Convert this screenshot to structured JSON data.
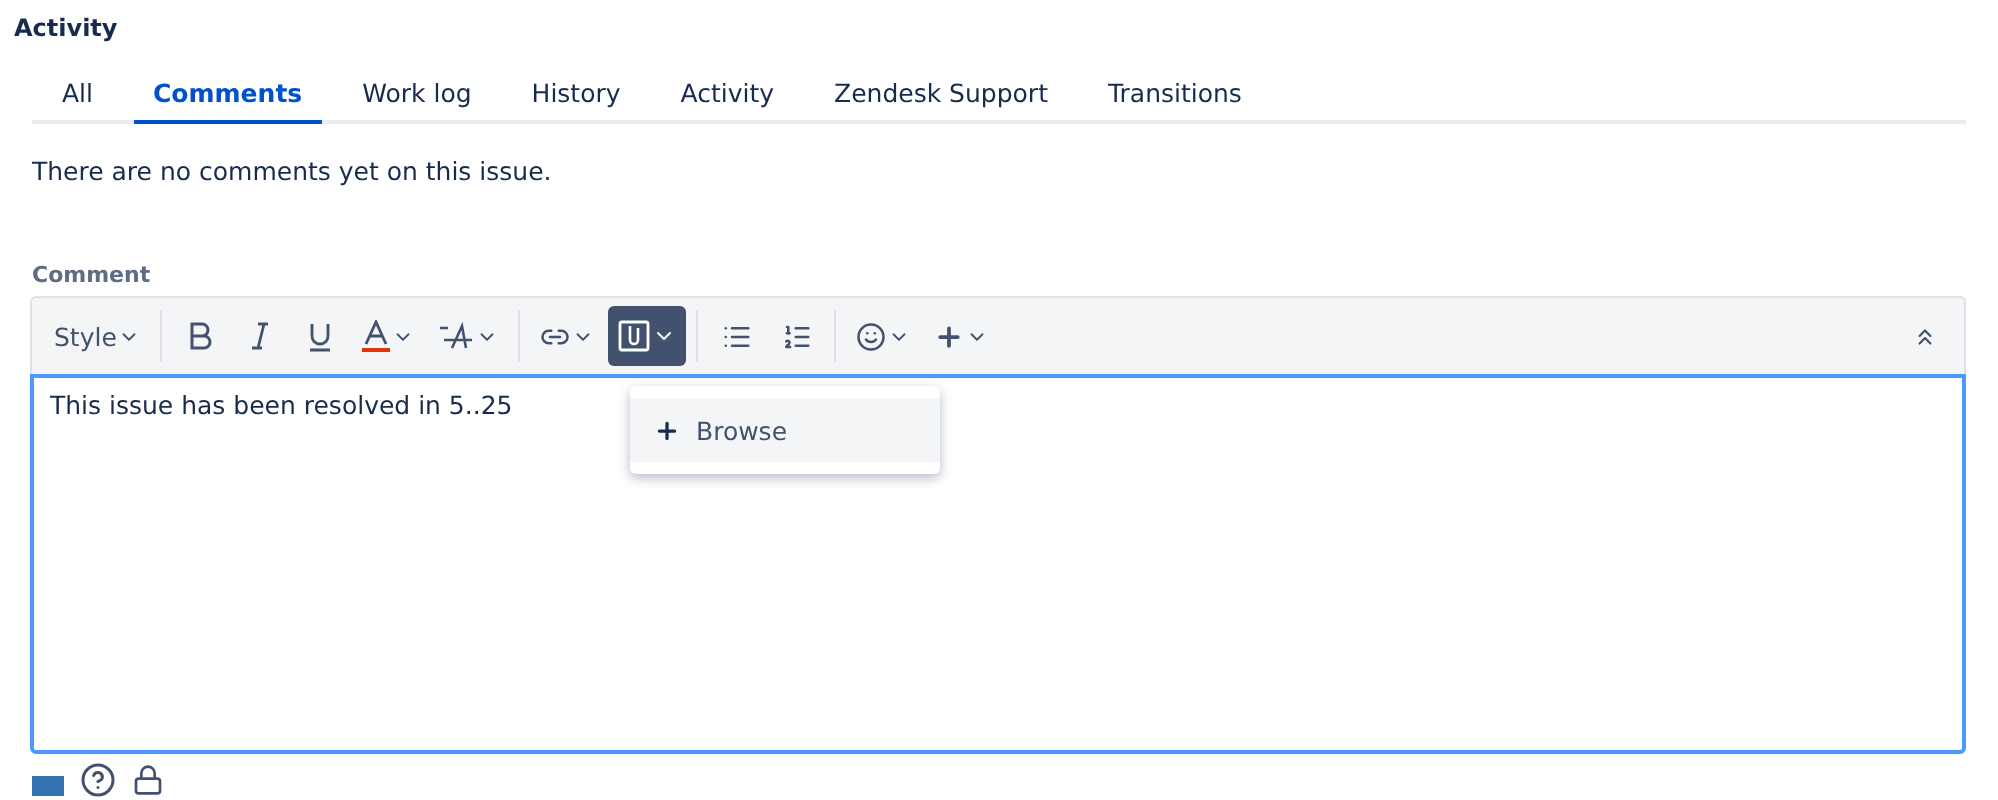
{
  "section_title": "Activity",
  "tabs": [
    {
      "label": "All",
      "selected": false
    },
    {
      "label": "Comments",
      "selected": true
    },
    {
      "label": "Work log",
      "selected": false
    },
    {
      "label": "History",
      "selected": false
    },
    {
      "label": "Activity",
      "selected": false
    },
    {
      "label": "Zendesk Support",
      "selected": false
    },
    {
      "label": "Transitions",
      "selected": false
    }
  ],
  "empty_message": "There are no comments yet on this issue.",
  "comment": {
    "label": "Comment",
    "style_button": "Style",
    "value": "This issue has been resolved in 5..25",
    "attachment_menu": {
      "open": true,
      "items": [
        "Browse"
      ]
    }
  }
}
